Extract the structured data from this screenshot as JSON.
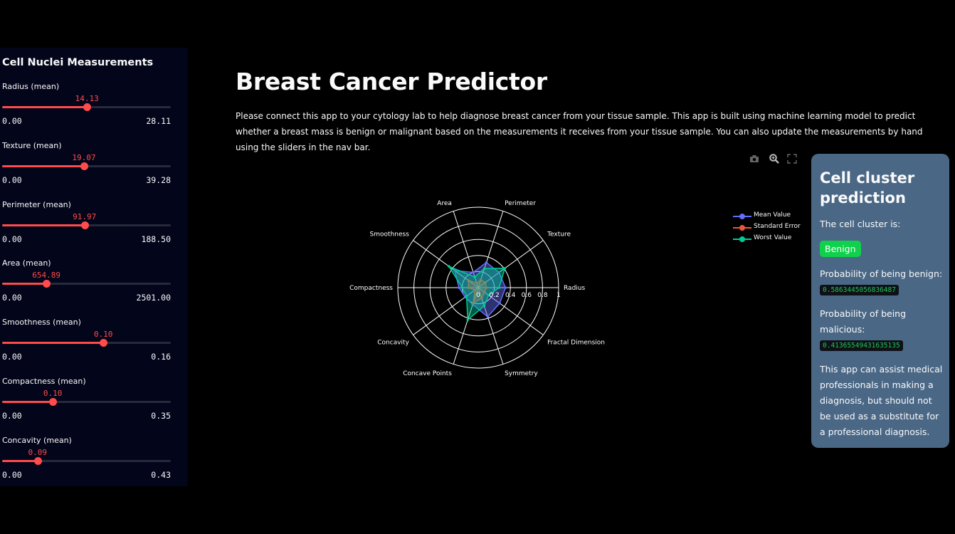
{
  "sidebar": {
    "title": "Cell Nuclei Measurements",
    "sliders": [
      {
        "label": "Radius (mean)",
        "value": "14.13",
        "min": "0.00",
        "max": "28.11",
        "fraction": 0.503
      },
      {
        "label": "Texture (mean)",
        "value": "19.07",
        "min": "0.00",
        "max": "39.28",
        "fraction": 0.485
      },
      {
        "label": "Perimeter (mean)",
        "value": "91.97",
        "min": "0.00",
        "max": "188.50",
        "fraction": 0.488
      },
      {
        "label": "Area (mean)",
        "value": "654.89",
        "min": "0.00",
        "max": "2501.00",
        "fraction": 0.262
      },
      {
        "label": "Smoothness (mean)",
        "value": "0.10",
        "min": "0.00",
        "max": "0.16",
        "fraction": 0.6
      },
      {
        "label": "Compactness (mean)",
        "value": "0.10",
        "min": "0.00",
        "max": "0.35",
        "fraction": 0.3
      },
      {
        "label": "Concavity (mean)",
        "value": "0.09",
        "min": "0.00",
        "max": "0.43",
        "fraction": 0.21
      }
    ]
  },
  "main": {
    "title": "Breast Cancer Predictor",
    "description": "Please connect this app to your cytology lab to help diagnose breast cancer from your tissue sample. This app is built using machine learning model to predict whether a breast mass is benign or malignant based on the measurements it receives from your tissue sample. You can also update the measurements by hand using the sliders in the nav bar."
  },
  "toolbar": {
    "icons": [
      "camera-icon",
      "zoom-icon",
      "autoscale-icon"
    ]
  },
  "chart_data": {
    "type": "radar",
    "categories": [
      "Radius",
      "Texture",
      "Perimeter",
      "Area",
      "Smoothness",
      "Compactness",
      "Concavity",
      "Concave Points",
      "Symmetry",
      "Fractal Dimension"
    ],
    "radial_range": [
      0,
      1
    ],
    "radial_ticks": [
      "0",
      "0.2",
      "0.4",
      "0.6",
      "0.8",
      "1"
    ],
    "series": [
      {
        "name": "Mean Value",
        "color": "#636efa",
        "values": [
          0.34,
          0.32,
          0.33,
          0.2,
          0.36,
          0.24,
          0.2,
          0.22,
          0.38,
          0.33
        ]
      },
      {
        "name": "Standard Error",
        "color": "#ef553b",
        "values": [
          0.1,
          0.11,
          0.1,
          0.06,
          0.15,
          0.12,
          0.05,
          0.2,
          0.14,
          0.1
        ]
      },
      {
        "name": "Worst Value",
        "color": "#00cc96",
        "values": [
          0.26,
          0.41,
          0.25,
          0.14,
          0.45,
          0.2,
          0.18,
          0.42,
          0.24,
          0.16
        ]
      }
    ]
  },
  "prediction": {
    "title": "Cell cluster prediction",
    "intro": "The cell cluster is:",
    "result": "Benign",
    "benign_label": "Probability of being benign:",
    "benign_value": "0.5863445056836487",
    "malicious_label": "Probability of being malicious:",
    "malicious_value": "0.41365549431635135",
    "disclaimer": "This app can assist medical professionals in making a diagnosis, but should not be used as a substitute for a professional diagnosis."
  }
}
